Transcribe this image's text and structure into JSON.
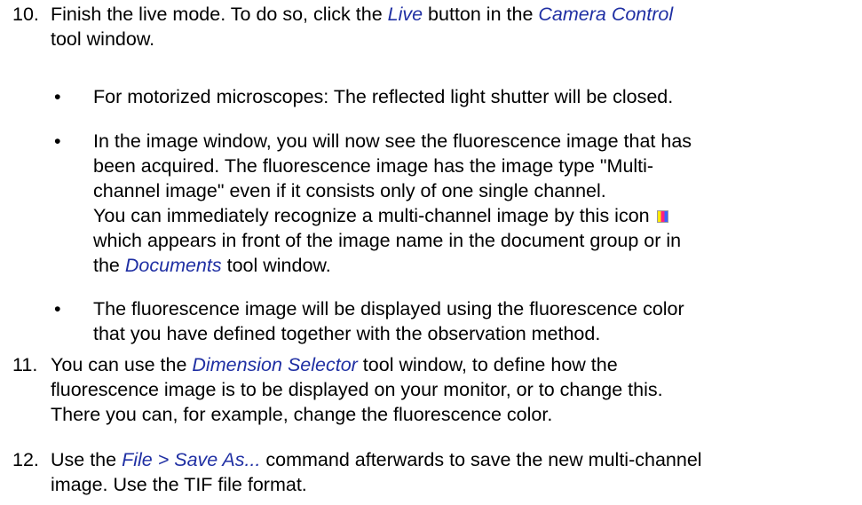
{
  "step10": {
    "number": "10.",
    "line1_pre": "Finish the live mode. To do so, click the ",
    "line1_ui1": "Live",
    "line1_mid": " button in the ",
    "line1_ui2": "Camera Control",
    "line2": "tool window.",
    "bullet_char": "•",
    "bullets": [
      {
        "lines": [
          "For motorized microscopes: The reflected light shutter will be closed."
        ]
      },
      {
        "lines": [
          "In the image window, you will now see the fluorescence image that has",
          "been acquired. The fluorescence image has the image type \"Multi-",
          "channel image\" even if it consists only of one single channel."
        ],
        "extra_line1": "You can immediately recognize a multi-channel image by this icon",
        "extra_line2": "which appears in front of the image name in the document group or in",
        "extra_line3_pre": "the ",
        "extra_line3_ui": "Documents",
        "extra_line3_post": " tool window.",
        "icon": "multichannel-image-icon"
      },
      {
        "lines": [
          "The fluorescence image will be displayed using the fluorescence color",
          "that you have defined together with the observation method."
        ]
      }
    ]
  },
  "step11": {
    "number": "11.",
    "line1_pre": "You can use the ",
    "line1_ui": "Dimension Selector",
    "line1_post": " tool window, to define how the",
    "line2": "fluorescence image is to be displayed on your monitor, or to change this.",
    "line3": "There you can, for example, change the fluorescence color."
  },
  "step12": {
    "number": "12.",
    "line1_pre": "Use the ",
    "line1_ui": "File > Save As...",
    "line1_post": " command afterwards to save the new multi-channel",
    "line2": "image. Use the TIF file format."
  },
  "colors": {
    "text": "#000000",
    "ui_reference": "#1f2fa3",
    "background": "#ffffff"
  }
}
